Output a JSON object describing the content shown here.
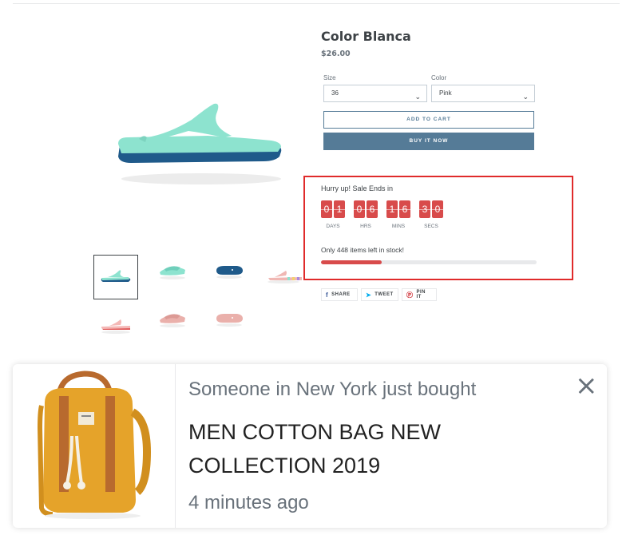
{
  "product": {
    "title": "Color Blanca",
    "price": "$26.00",
    "size_label": "Size",
    "size_value": "36",
    "color_label": "Color",
    "color_value": "Pink",
    "add_to_cart": "ADD TO CART",
    "buy_now": "BUY IT NOW"
  },
  "countdown": {
    "heading": "Hurry up! Sale Ends in",
    "days": [
      "0",
      "1"
    ],
    "hours": [
      "0",
      "6"
    ],
    "mins": [
      "1",
      "6"
    ],
    "secs": [
      "3",
      "0"
    ],
    "units": [
      "DAYS",
      "HRS",
      "MINS",
      "SECS"
    ],
    "stock_text": "Only 448 items left in stock!",
    "stock_progress": 0.28
  },
  "share": {
    "share": "SHARE",
    "tweet": "TWEET",
    "pin": "PIN IT"
  },
  "popup": {
    "who": "Someone in New York just bought",
    "product": "MEN COTTON BAG NEW COLLECTION 2019",
    "time": "4 minutes ago",
    "close": "×"
  },
  "colors": {
    "accent": "#557b97",
    "sale_red": "#d84b4b",
    "highlight_border": "#e02b2b",
    "sandal_mint": "#8de3cf",
    "sandal_navy": "#1f5a8a",
    "sandal_pink": "#f0b7b3",
    "bag_yellow": "#e5a32a"
  }
}
